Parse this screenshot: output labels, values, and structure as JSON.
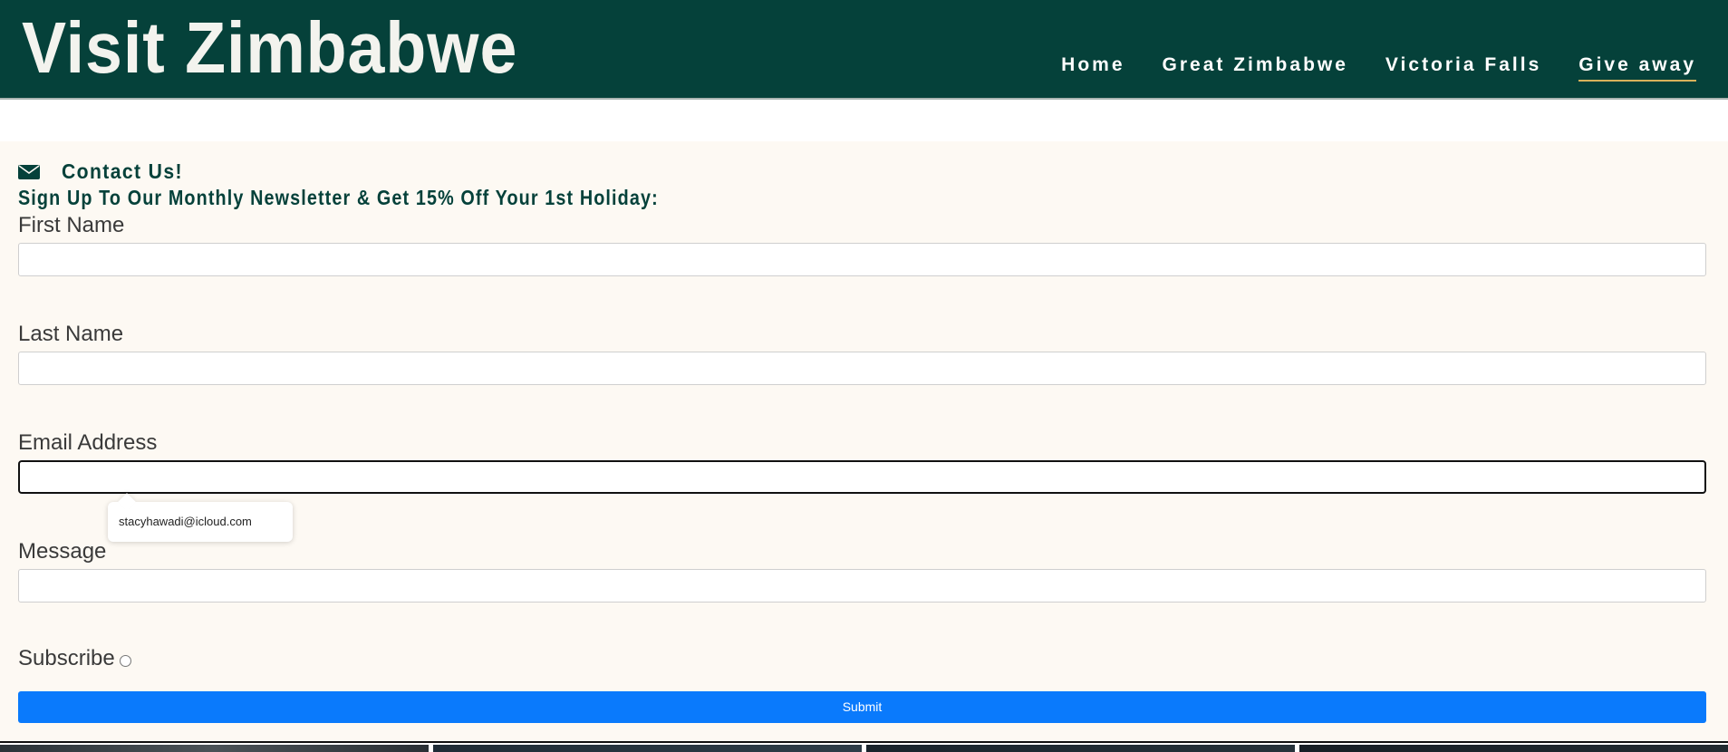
{
  "site": {
    "title": "Visit Zimbabwe"
  },
  "nav": {
    "items": [
      {
        "label": "Home",
        "active": false
      },
      {
        "label": "Great Zimbabwe",
        "active": false
      },
      {
        "label": "Victoria Falls",
        "active": false
      },
      {
        "label": "Give away",
        "active": true
      }
    ]
  },
  "contact": {
    "icon": "envelope-icon",
    "title": "Contact Us!",
    "subtitle": "Sign Up To Our Monthly Newsletter & Get 15% Off Your 1st Holiday:"
  },
  "form": {
    "first_name": {
      "label": "First Name",
      "value": ""
    },
    "last_name": {
      "label": "Last Name",
      "value": ""
    },
    "email": {
      "label": "Email Address",
      "value": ""
    },
    "autofill_suggestion": "stacyhawadi@icloud.com",
    "message": {
      "label": "Message",
      "value": ""
    },
    "subscribe": {
      "label": "Subscribe",
      "checked": false
    },
    "submit_label": "Submit"
  },
  "colors": {
    "header_bg": "#05413a",
    "form_bg": "#fdf9f3",
    "submit_bg": "#0a7afc",
    "nav_active_underline": "#d8b25a"
  }
}
